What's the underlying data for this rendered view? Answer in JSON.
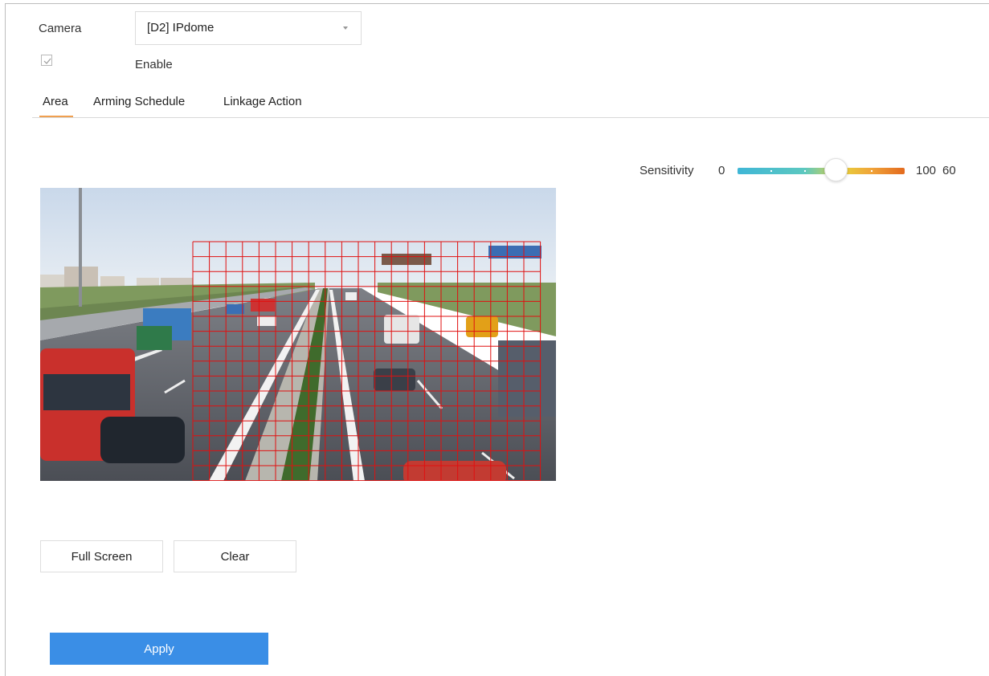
{
  "camera": {
    "label": "Camera",
    "selected": "[D2] IPdome"
  },
  "enable": {
    "label": "Enable",
    "checked": true
  },
  "tabs": [
    {
      "label": "Area",
      "active": true
    },
    {
      "label": "Arming Schedule",
      "active": false
    },
    {
      "label": "Linkage Action",
      "active": false
    }
  ],
  "sensitivity": {
    "label": "Sensitivity",
    "min": "0",
    "max": "100",
    "value": "60"
  },
  "video": {
    "grid_color": "#e01010"
  },
  "buttons": {
    "full_screen": "Full Screen",
    "clear": "Clear",
    "apply": "Apply"
  },
  "colors": {
    "accent": "#3a8ee6",
    "tab_underline": "#f0a050"
  }
}
